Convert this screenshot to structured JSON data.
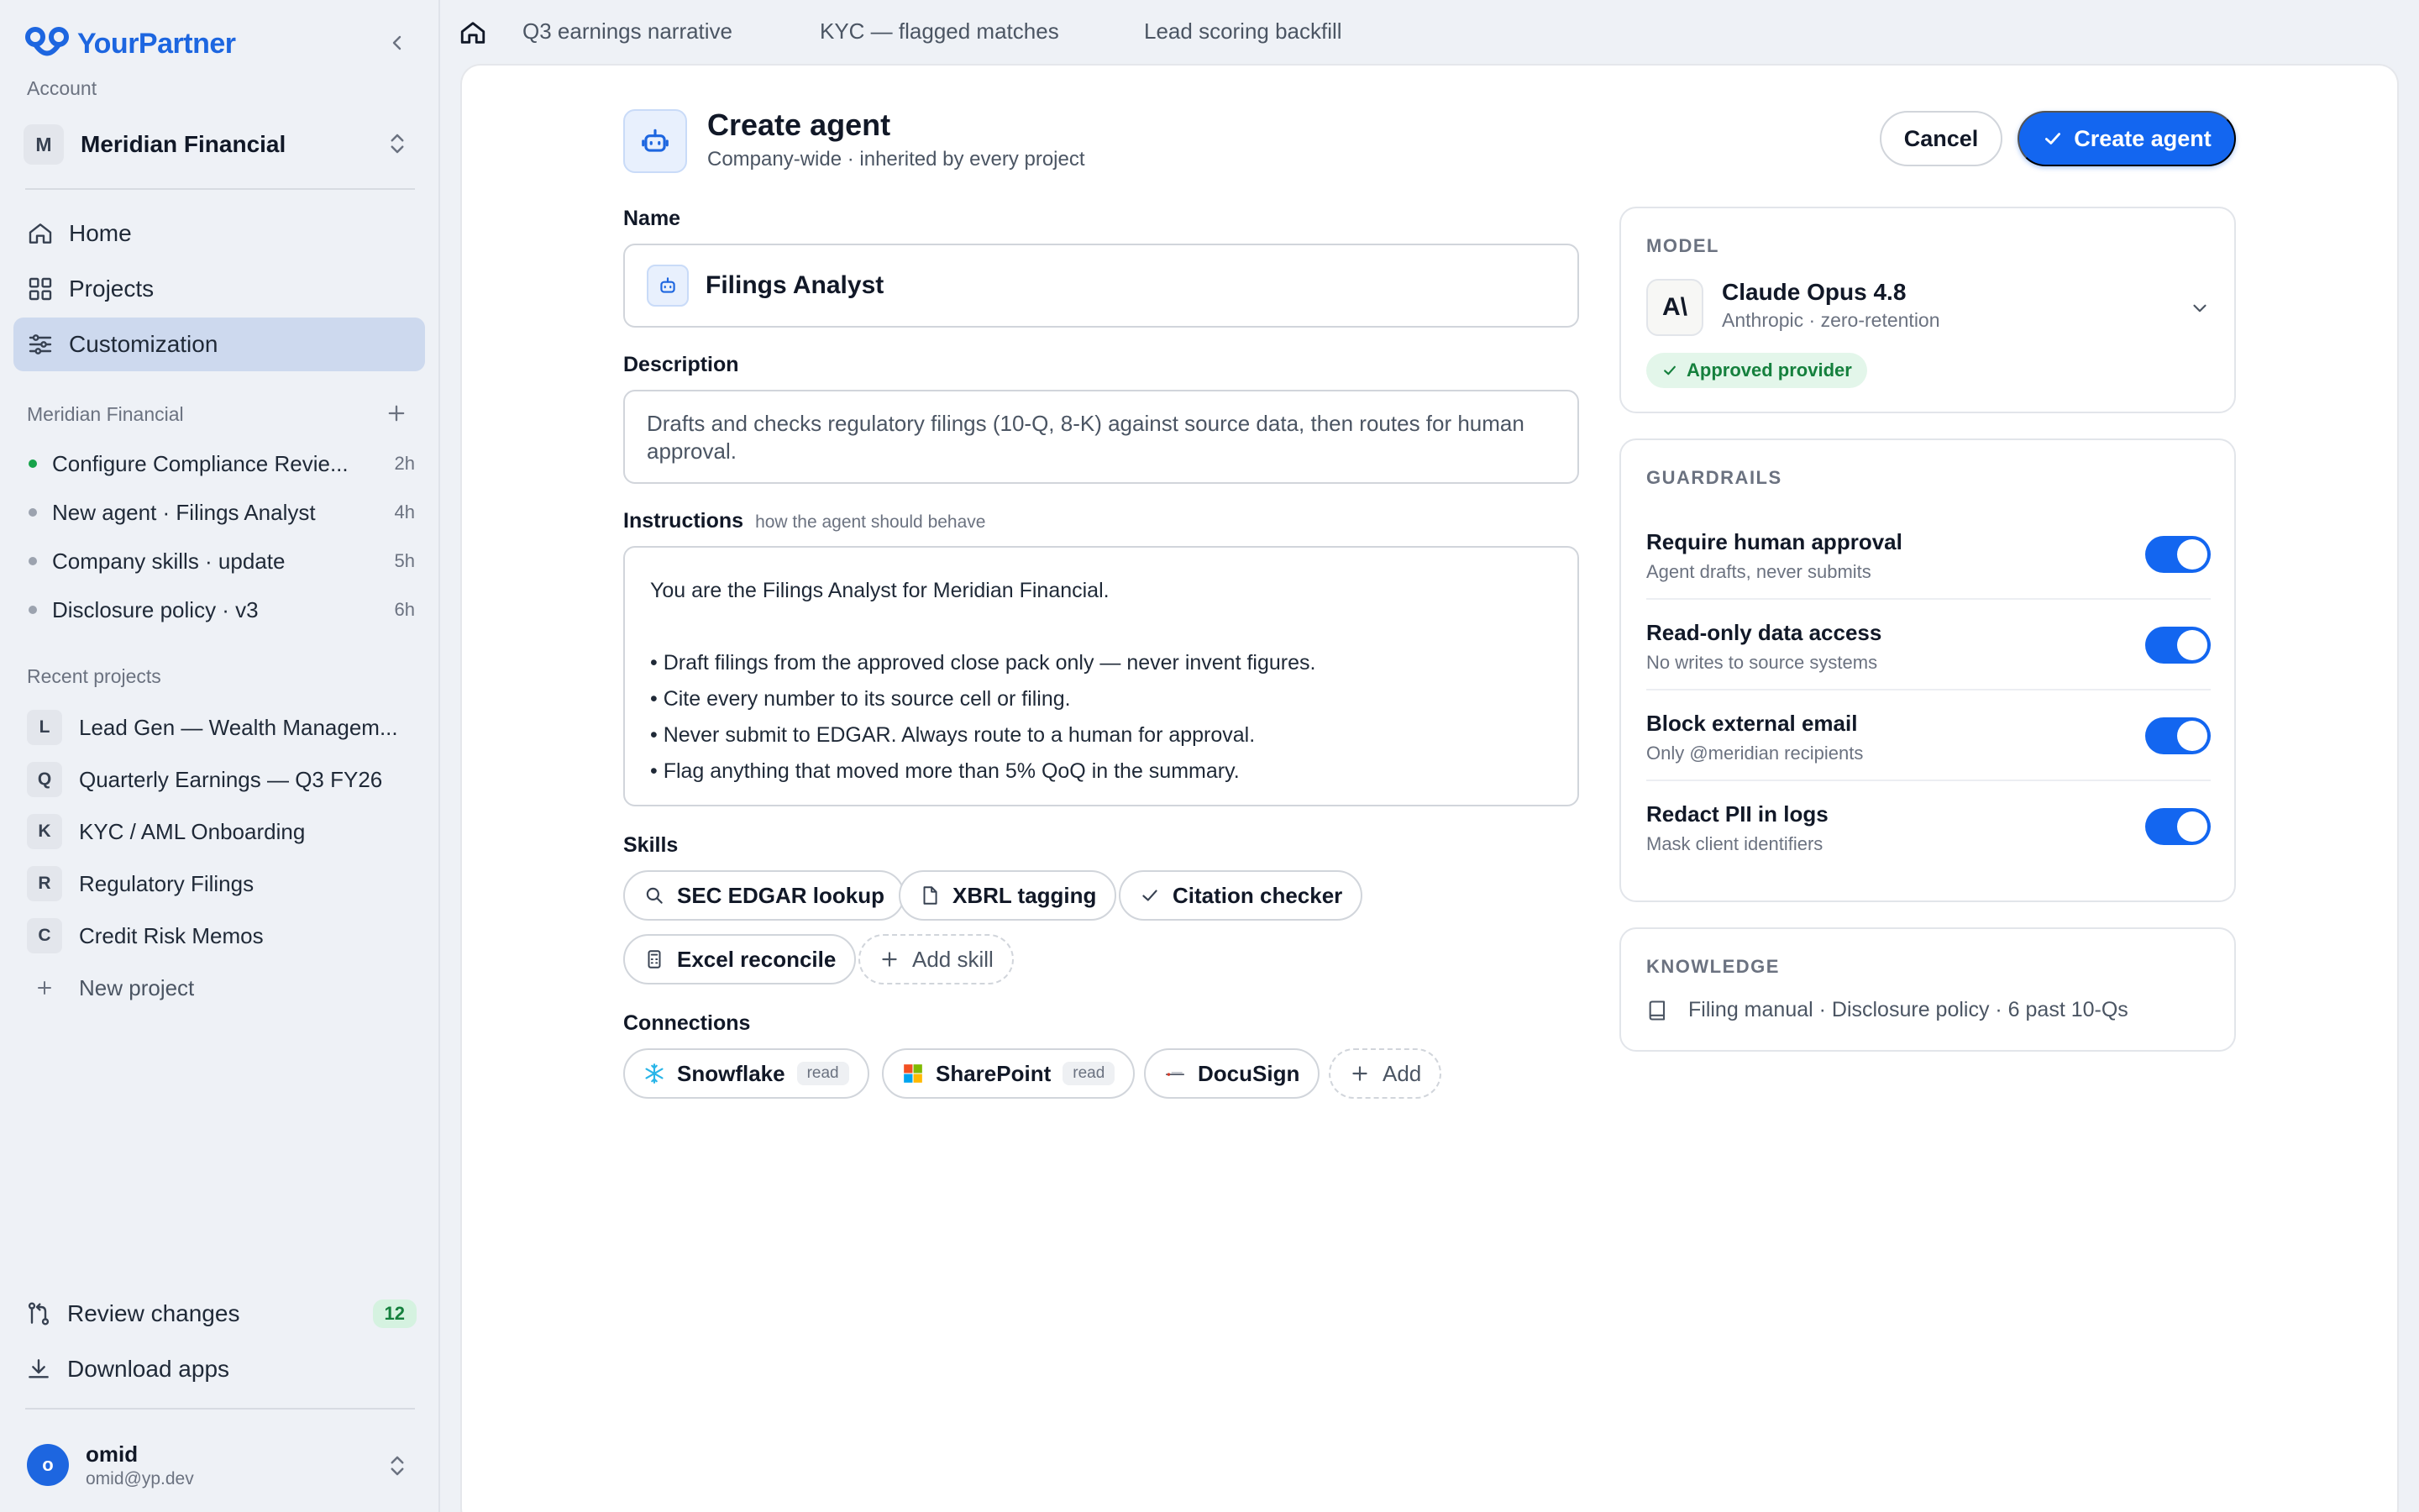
{
  "brand": {
    "name": "YourPartner",
    "accent": "#1d66e0"
  },
  "sidebar": {
    "account_label": "Account",
    "account": {
      "initial": "M",
      "name": "Meridian Financial"
    },
    "nav": [
      {
        "label": "Home",
        "icon": "home-icon"
      },
      {
        "label": "Projects",
        "icon": "grid-icon"
      },
      {
        "label": "Customization",
        "icon": "sliders-icon",
        "active": true
      }
    ],
    "workspace_label": "Meridian Financial",
    "tasks": [
      {
        "label": "Configure Compliance Revie...",
        "time": "2h",
        "status": "active"
      },
      {
        "label": "New agent · Filings Analyst",
        "time": "4h"
      },
      {
        "label": "Company skills · update",
        "time": "5h"
      },
      {
        "label": "Disclosure policy · v3",
        "time": "6h"
      }
    ],
    "recent_label": "Recent projects",
    "projects": [
      {
        "initial": "L",
        "label": "Lead Gen — Wealth Managem..."
      },
      {
        "initial": "Q",
        "label": "Quarterly Earnings — Q3 FY26"
      },
      {
        "initial": "K",
        "label": "KYC / AML Onboarding"
      },
      {
        "initial": "R",
        "label": "Regulatory Filings"
      },
      {
        "initial": "C",
        "label": "Credit Risk Memos"
      }
    ],
    "new_project": "New project",
    "review_changes": {
      "label": "Review changes",
      "count": "12"
    },
    "download_apps": "Download apps",
    "user": {
      "initial": "o",
      "name": "omid",
      "email": "omid@yp.dev"
    }
  },
  "tabs": [
    {
      "label": "Q3 earnings narrative"
    },
    {
      "label": "KYC — flagged matches"
    },
    {
      "label": "Lead scoring backfill"
    }
  ],
  "header": {
    "title": "Create agent",
    "subtitle": "Company-wide · inherited by every project",
    "cancel": "Cancel",
    "create": "Create agent"
  },
  "form": {
    "name_label": "Name",
    "name_value": "Filings Analyst",
    "description_label": "Description",
    "description_value": "Drafts and checks regulatory filings (10-Q, 8-K) against source data, then routes for human approval.",
    "instructions_label": "Instructions",
    "instructions_hint": "how the agent should behave",
    "instructions": {
      "intro": "You are the Filings Analyst for Meridian Financial.",
      "bullets": [
        "• Draft filings from the approved close pack only — never invent figures.",
        "• Cite every number to its source cell or filing.",
        "• Never submit to EDGAR. Always route to a human for approval.",
        "• Flag anything that moved more than 5% QoQ in the summary."
      ]
    },
    "skills_label": "Skills",
    "skills": [
      {
        "label": "SEC EDGAR lookup",
        "icon": "search-icon"
      },
      {
        "label": "XBRL tagging",
        "icon": "document-icon"
      },
      {
        "label": "Citation checker",
        "icon": "check-icon"
      },
      {
        "label": "Excel reconcile",
        "icon": "calculator-icon"
      }
    ],
    "add_skill": "Add skill",
    "connections_label": "Connections",
    "connections": [
      {
        "label": "Snowflake",
        "tag": "read",
        "icon": "snowflake-icon"
      },
      {
        "label": "SharePoint",
        "tag": "read",
        "icon": "microsoft-icon"
      },
      {
        "label": "DocuSign",
        "icon": "docusign-icon"
      }
    ],
    "add_connection": "Add"
  },
  "model": {
    "section": "MODEL",
    "logo": "A\\",
    "name": "Claude Opus 4.8",
    "sub": "Anthropic · zero-retention",
    "badge": "Approved provider"
  },
  "guardrails": {
    "section": "GUARDRAILS",
    "items": [
      {
        "title": "Require human approval",
        "sub": "Agent drafts, never submits",
        "on": true
      },
      {
        "title": "Read-only data access",
        "sub": "No writes to source systems",
        "on": true
      },
      {
        "title": "Block external email",
        "sub": "Only @meridian recipients",
        "on": true
      },
      {
        "title": "Redact PII in logs",
        "sub": "Mask client identifiers",
        "on": true
      }
    ]
  },
  "knowledge": {
    "section": "KNOWLEDGE",
    "summary": "Filing manual · Disclosure policy · 6 past 10-Qs"
  },
  "colors": {
    "primary": "#1366f0",
    "success": "#15803d",
    "active_nav": "#cdd9ee"
  }
}
